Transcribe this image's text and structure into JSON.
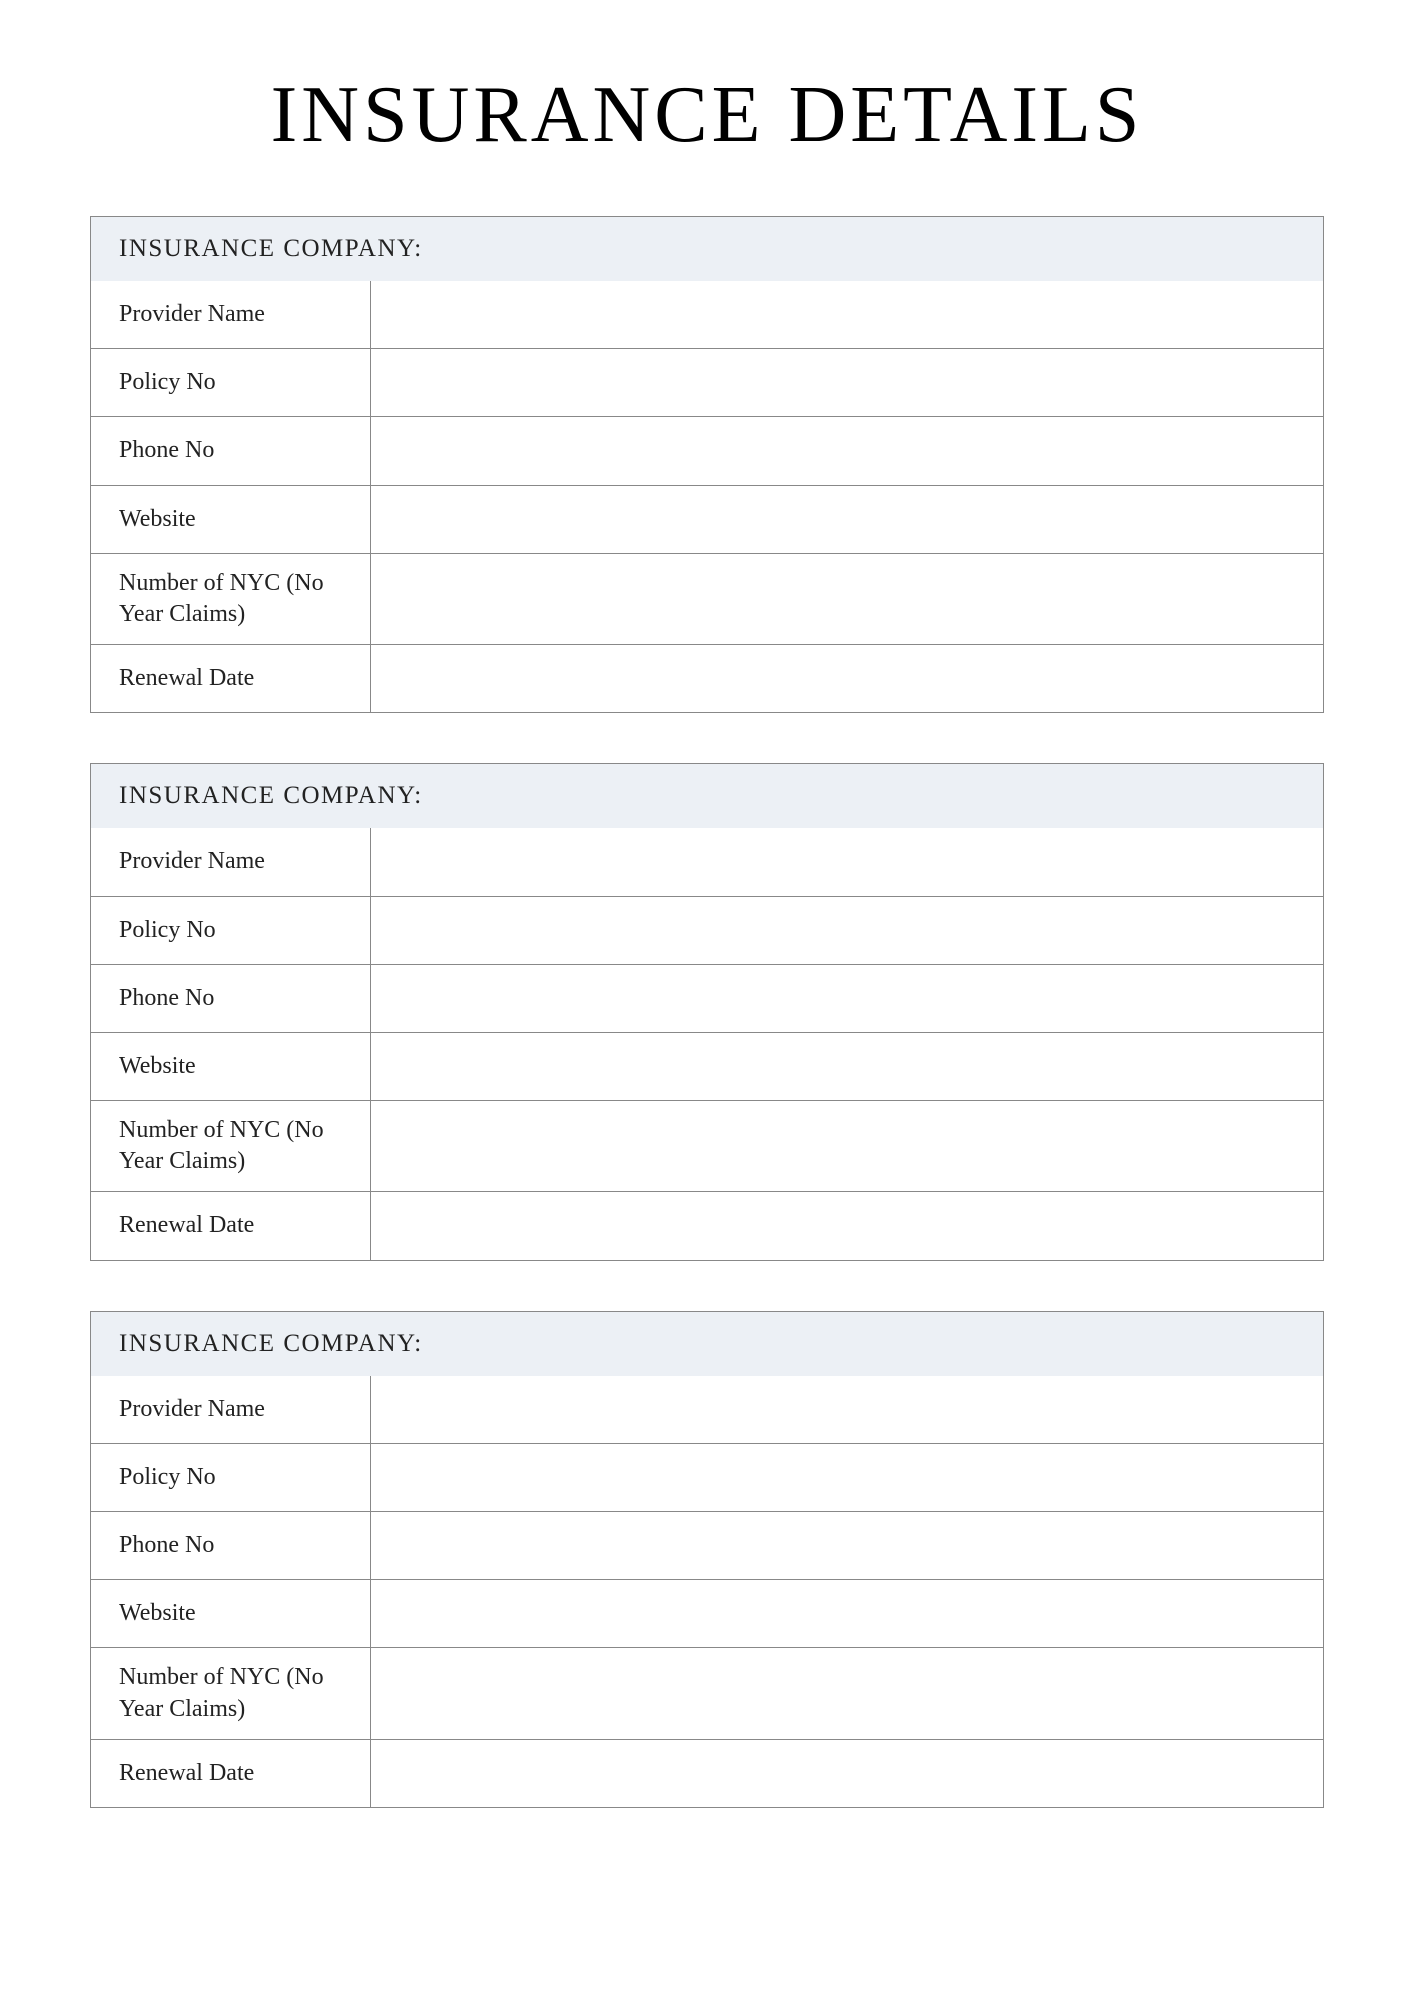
{
  "title": "INSURANCE DETAILS",
  "sections": [
    {
      "header": "INSURANCE COMPANY:",
      "rows": [
        {
          "label": "Provider Name",
          "value": ""
        },
        {
          "label": "Policy No",
          "value": ""
        },
        {
          "label": "Phone No",
          "value": ""
        },
        {
          "label": "Website",
          "value": ""
        },
        {
          "label": "Number of NYC (No Year Claims)",
          "value": ""
        },
        {
          "label": "Renewal Date",
          "value": ""
        }
      ]
    },
    {
      "header": "INSURANCE COMPANY:",
      "rows": [
        {
          "label": "Provider Name",
          "value": ""
        },
        {
          "label": "Policy No",
          "value": ""
        },
        {
          "label": "Phone No",
          "value": ""
        },
        {
          "label": "Website",
          "value": ""
        },
        {
          "label": "Number of NYC (No Year Claims)",
          "value": ""
        },
        {
          "label": "Renewal Date",
          "value": ""
        }
      ]
    },
    {
      "header": "INSURANCE COMPANY:",
      "rows": [
        {
          "label": "Provider Name",
          "value": ""
        },
        {
          "label": "Policy No",
          "value": ""
        },
        {
          "label": "Phone No",
          "value": ""
        },
        {
          "label": "Website",
          "value": ""
        },
        {
          "label": "Number of NYC (No Year Claims)",
          "value": ""
        },
        {
          "label": "Renewal Date",
          "value": ""
        }
      ]
    }
  ]
}
